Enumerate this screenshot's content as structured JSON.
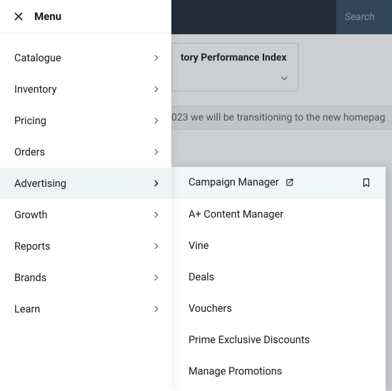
{
  "header": {
    "menu_title": "Menu"
  },
  "bg": {
    "search_placeholder": "Search",
    "card_title": "tory Performance Index",
    "banner_text": "023 we will be transitioning to the new homepag"
  },
  "menu": {
    "items": [
      {
        "label": "Catalogue"
      },
      {
        "label": "Inventory"
      },
      {
        "label": "Pricing"
      },
      {
        "label": "Orders"
      },
      {
        "label": "Advertising"
      },
      {
        "label": "Growth"
      },
      {
        "label": "Reports"
      },
      {
        "label": "Brands"
      },
      {
        "label": "Learn"
      }
    ]
  },
  "submenu": {
    "items": [
      {
        "label": "Campaign Manager"
      },
      {
        "label": "A+ Content Manager"
      },
      {
        "label": "Vine"
      },
      {
        "label": "Deals"
      },
      {
        "label": "Vouchers"
      },
      {
        "label": "Prime Exclusive Discounts"
      },
      {
        "label": "Manage Promotions"
      }
    ]
  }
}
